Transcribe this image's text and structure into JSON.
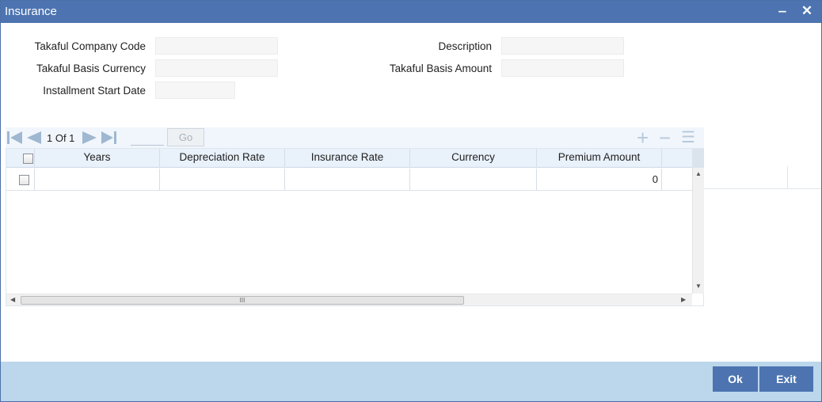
{
  "window": {
    "title": "Insurance",
    "minimize_glyph": "‒",
    "close_glyph": "✕"
  },
  "form": {
    "company_code_label": "Takaful Company Code",
    "company_code_value": "",
    "description_label": "Description",
    "description_value": "",
    "basis_currency_label": "Takaful Basis Currency",
    "basis_currency_value": "",
    "basis_amount_label": "Takaful Basis Amount",
    "basis_amount_value": "",
    "start_date_label": "Installment Start Date",
    "start_date_value": ""
  },
  "pager": {
    "page_info": "1 Of 1",
    "page_input": "",
    "go_label": "Go",
    "add_glyph": "+",
    "remove_glyph": "−",
    "list_glyph": "☰"
  },
  "grid": {
    "columns": [
      "Years",
      "Depreciation Rate",
      "Insurance Rate",
      "Currency",
      "Premium Amount"
    ],
    "rows": [
      {
        "years": "",
        "depreciation_rate": "",
        "insurance_rate": "",
        "currency": "",
        "premium_amount": "0"
      }
    ],
    "scroll_thumb_grip": "III"
  },
  "footer": {
    "ok_label": "Ok",
    "exit_label": "Exit"
  },
  "colors": {
    "titlebar": "#4d74b0",
    "footer": "#bcd6ec",
    "header_row": "#e9f1fb",
    "nav_icon": "#9fb7d1"
  }
}
